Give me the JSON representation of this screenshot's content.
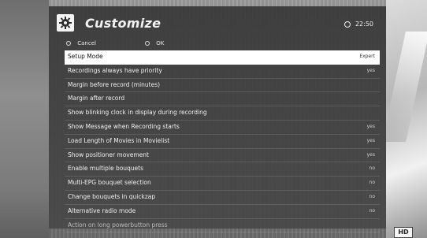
{
  "header": {
    "title": "Customize",
    "clock": "22:50"
  },
  "options": {
    "cancel": "Cancel",
    "ok": "OK"
  },
  "rows": [
    {
      "label": "Setup Mode",
      "value": "Expert"
    },
    {
      "label": "Recordings always have priority",
      "value": "yes"
    },
    {
      "label": "Margin before record (minutes)",
      "value": ""
    },
    {
      "label": "Margin after record",
      "value": ""
    },
    {
      "label": "Show blinking clock in display during recording",
      "value": ""
    },
    {
      "label": "Show Message when Recording starts",
      "value": "yes"
    },
    {
      "label": "Load Length of Movies in Movielist",
      "value": "yes"
    },
    {
      "label": "Show positioner movement",
      "value": "yes"
    },
    {
      "label": "Enable multiple bouquets",
      "value": "no"
    },
    {
      "label": "Multi-EPG bouquet selection",
      "value": "no"
    },
    {
      "label": "Change bouquets in quickzap",
      "value": "no"
    },
    {
      "label": "Alternative radio mode",
      "value": "no"
    },
    {
      "label": "Action on long powerbutton press",
      "value": ""
    }
  ],
  "badge": {
    "hd": "HD"
  }
}
